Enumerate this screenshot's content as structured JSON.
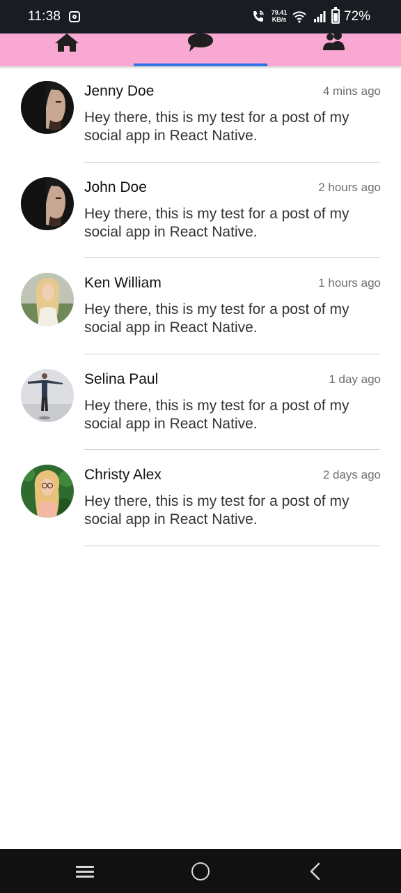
{
  "status_bar": {
    "time": "11:38",
    "net_speed_value": "79.41",
    "net_speed_unit": "KB/s",
    "battery": "72%"
  },
  "tabs": [
    {
      "name": "home",
      "icon": "home-icon",
      "active": false
    },
    {
      "name": "messages",
      "icon": "chat-bubble-icon",
      "active": true
    },
    {
      "name": "friends",
      "icon": "users-icon",
      "active": false
    }
  ],
  "colors": {
    "tab_bar": "#f9a8d4",
    "active_indicator": "#2f73e6",
    "status_bar": "#191c22",
    "nav_bar": "#111111"
  },
  "messages": [
    {
      "name": "Jenny Doe",
      "time": "4 mins ago",
      "text": "Hey there, this is my test for a post of my social app in React Native."
    },
    {
      "name": "John Doe",
      "time": "2 hours ago",
      "text": "Hey there, this is my test for a post of my social app in React Native."
    },
    {
      "name": "Ken William",
      "time": "1 hours ago",
      "text": "Hey there, this is my test for a post of my social app in React Native."
    },
    {
      "name": "Selina Paul",
      "time": "1 day ago",
      "text": "Hey there, this is my test for a post of my social app in React Native."
    },
    {
      "name": "Christy Alex",
      "time": "2 days ago",
      "text": "Hey there, this is my test for a post of my social app in React Native."
    }
  ],
  "nav_bar": {
    "items": [
      "menu-icon",
      "home-circle-icon",
      "back-chevron-icon"
    ]
  }
}
